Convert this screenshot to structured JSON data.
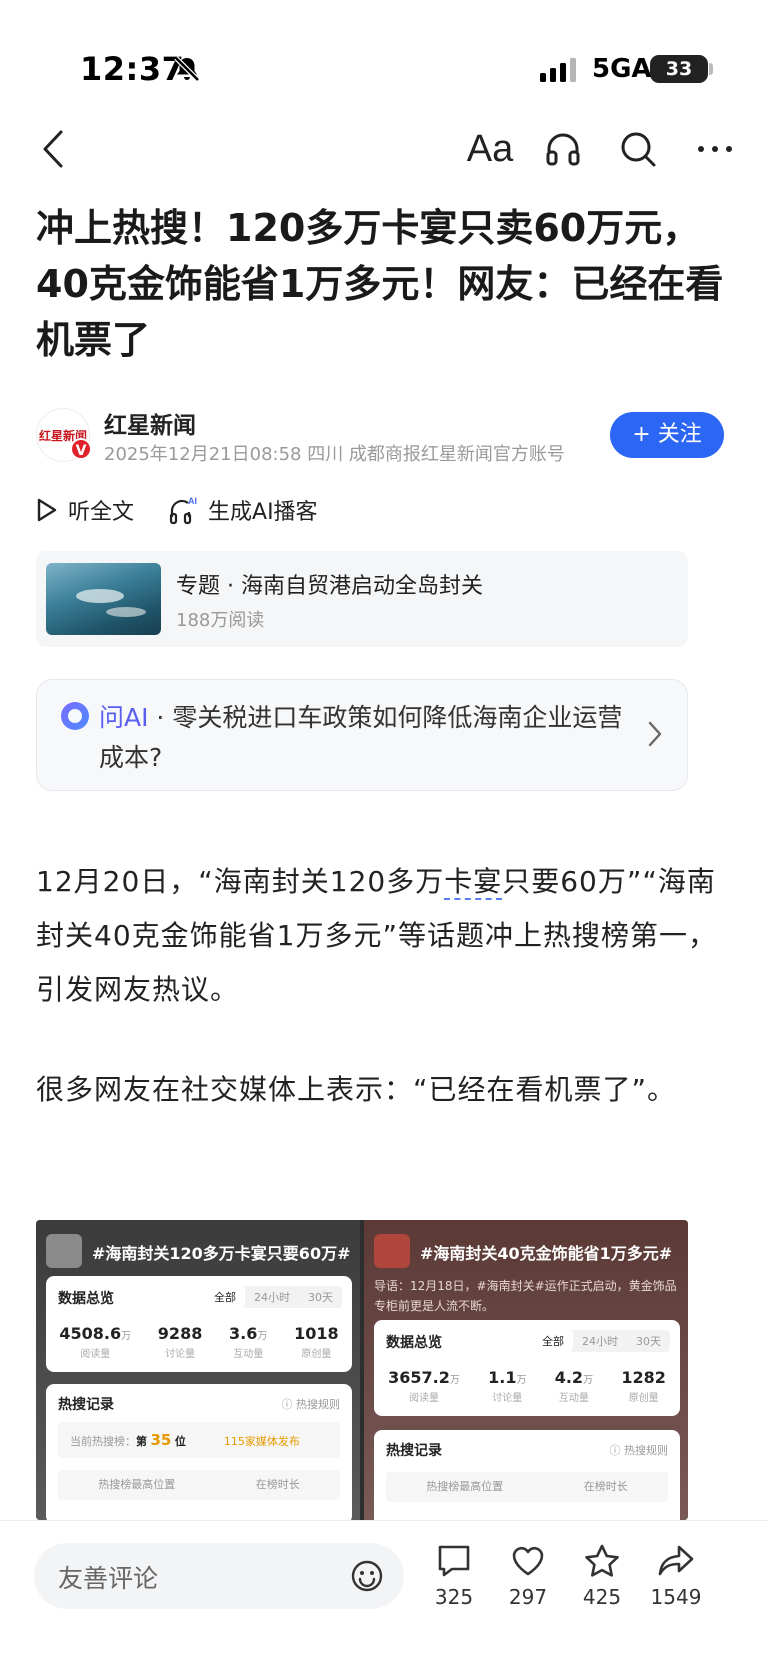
{
  "status_bar": {
    "time": "12:37",
    "network": "5GA",
    "battery": "33"
  },
  "nav": {
    "font_label": "Aa"
  },
  "article": {
    "title": "冲上热搜！120多万卡宴只卖60万元，40克金饰能省1万多元！网友：已经在看机票了"
  },
  "author": {
    "name": "红星新闻",
    "avatar_text": "红星新闻",
    "badge": "V",
    "meta": "2025年12月21日08:58 四川 成都商报红星新闻官方账号",
    "follow_label": "+ 关注"
  },
  "listen": {
    "read_full": "听全文",
    "ai_podcast": "生成AI播客",
    "ai_superscript": "AI"
  },
  "topic": {
    "title": "专题 · 海南自贸港启动全岛封关",
    "reads": "188万阅读"
  },
  "ask_ai": {
    "label": "问AI",
    "separator": " · ",
    "question": "零关税进口车政策如何降低海南企业运营成本?"
  },
  "body": {
    "p1_a": "12月20日，“海南封关120多万",
    "p1_kw": "卡宴",
    "p1_b": "只要60万”“海南封关40克金饰能省1万多元”等话题冲上热搜榜第一，引发网友热议。",
    "p2": "很多网友在社交媒体上表示：“已经在看机票了”。"
  },
  "figure": {
    "left": {
      "tag": "#海南封关120多万卡宴只要60万#",
      "overview": "数据总览",
      "tabs": [
        "全部",
        "24小时",
        "30天"
      ],
      "stats": [
        {
          "value": "4508.6",
          "unit": "万",
          "label": "阅读量"
        },
        {
          "value": "9288",
          "unit": "",
          "label": "讨论量"
        },
        {
          "value": "3.6",
          "unit": "万",
          "label": "互动量"
        },
        {
          "value": "1018",
          "unit": "",
          "label": "原创量"
        }
      ],
      "hot_label": "热搜记录",
      "hot_rule": "ⓘ 热搜规则",
      "rank_prefix": "当前热搜榜：",
      "rank_di": "第",
      "rank_num": "35",
      "rank_wei": "位",
      "media": "115家媒体发布",
      "sub_left": "热搜榜最高位置",
      "sub_right": "在榜时长"
    },
    "right": {
      "tag": "#海南封关40克金饰能省1万多元#",
      "intro": "导语：12月18日，#海南封关#运作正式启动，黄金饰品专柜前更是人流不断。",
      "overview": "数据总览",
      "tabs": [
        "全部",
        "24小时",
        "30天"
      ],
      "stats": [
        {
          "value": "3657.2",
          "unit": "万",
          "label": "阅读量"
        },
        {
          "value": "1.1",
          "unit": "万",
          "label": "讨论量"
        },
        {
          "value": "4.2",
          "unit": "万",
          "label": "互动量"
        },
        {
          "value": "1282",
          "unit": "",
          "label": "原创量"
        }
      ],
      "hot_label": "热搜记录",
      "hot_rule": "ⓘ 热搜规则",
      "sub_left": "热搜榜最高位置",
      "sub_right": "在榜时长"
    }
  },
  "bottom_bar": {
    "comment_placeholder": "友善评论",
    "comments": "325",
    "likes": "297",
    "favorites": "425",
    "shares": "1549"
  }
}
